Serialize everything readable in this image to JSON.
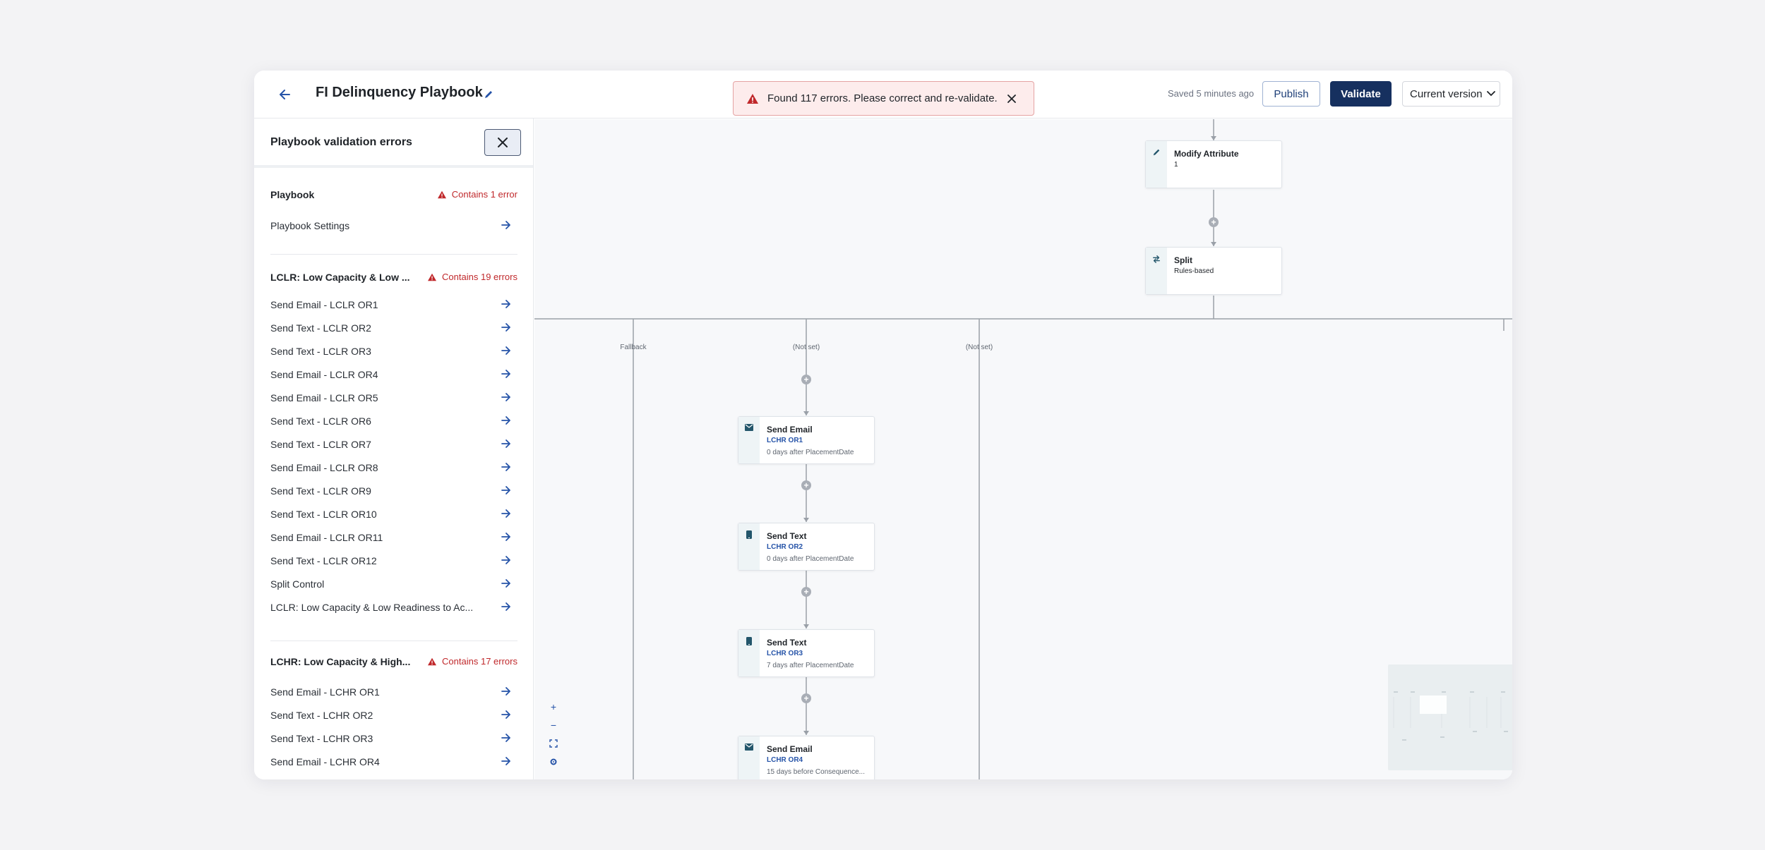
{
  "header": {
    "title": "FI Delinquency Playbook",
    "saved_text": "Saved 5 minutes ago",
    "publish_label": "Publish",
    "validate_label": "Validate",
    "version_label": "Current version"
  },
  "error_banner": {
    "message": "Found 117 errors. Please correct and re-validate."
  },
  "panel": {
    "title": "Playbook validation errors",
    "groups": [
      {
        "name": "Playbook",
        "error": "Contains 1 error",
        "items": [
          "Playbook Settings"
        ]
      },
      {
        "name": "LCLR: Low Capacity & Low ...",
        "error": "Contains 19 errors",
        "items": [
          "Send Email - LCLR OR1",
          "Send Text - LCLR OR2",
          "Send Text - LCLR OR3",
          "Send Email - LCLR OR4",
          "Send Email - LCLR OR5",
          "Send Text - LCLR OR6",
          "Send Text - LCLR OR7",
          "Send Email - LCLR OR8",
          "Send Text - LCLR OR9",
          "Send Text - LCLR OR10",
          "Send Email - LCLR OR11",
          "Send Text - LCLR OR12",
          "Split Control",
          "LCLR: Low Capacity & Low Readiness to Ac..."
        ]
      },
      {
        "name": "LCHR: Low Capacity & High...",
        "error": "Contains 17 errors",
        "items": [
          "Send Email - LCHR OR1",
          "Send Text - LCHR OR2",
          "Send Text - LCHR OR3",
          "Send Email - LCHR OR4"
        ]
      }
    ]
  },
  "canvas": {
    "nodes": {
      "modify": {
        "title": "Modify Attribute",
        "sub": "1",
        "icon": "pencil-icon"
      },
      "split": {
        "title": "Split",
        "sub": "Rules-based",
        "icon": "split-icon"
      },
      "email1": {
        "title": "Send Email",
        "code": "LCHR OR1",
        "meta": "0 days after PlacementDate",
        "icon": "envelope-icon"
      },
      "text2": {
        "title": "Send Text",
        "code": "LCHR OR2",
        "meta": "0 days after PlacementDate",
        "icon": "phone-icon"
      },
      "text3": {
        "title": "Send Text",
        "code": "LCHR OR3",
        "meta": "7 days after PlacementDate",
        "icon": "phone-icon"
      },
      "email4": {
        "title": "Send Email",
        "code": "LCHR OR4",
        "meta": "15 days before Consequence...",
        "icon": "envelope-icon"
      }
    },
    "branches": {
      "fallback": "Fallback",
      "notset1": "(Not set)",
      "notset2": "(Not set)"
    },
    "zoom": {
      "in": "+",
      "out": "−"
    }
  },
  "colors": {
    "primary": "#16305f",
    "link": "#2553a8",
    "error": "#c0282b",
    "banner_bg": "#fdecec"
  }
}
